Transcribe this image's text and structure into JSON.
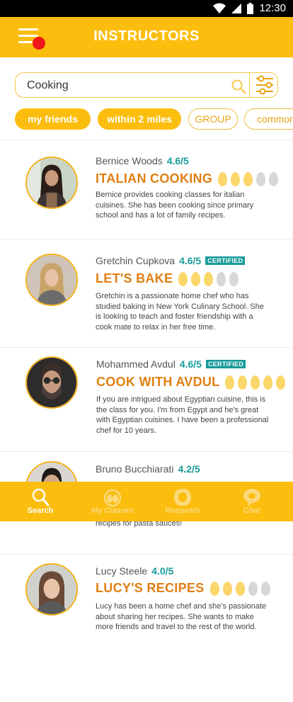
{
  "status_bar": {
    "time": "12:30"
  },
  "header": {
    "title": "INSTRUCTORS"
  },
  "search": {
    "value": "Cooking"
  },
  "filters": [
    {
      "label": "my friends",
      "active": true
    },
    {
      "label": "within 2 miles",
      "active": true
    },
    {
      "label": "GROUP",
      "active": false
    },
    {
      "label": "common",
      "active": false
    }
  ],
  "instructors": [
    {
      "name": "Bernice Woods",
      "rating": "4.6/5",
      "certified": false,
      "course": "ITALIAN COOKING",
      "eggs_filled": 3,
      "eggs_total": 5,
      "description": "Bernice provides cooking classes for italian cuisines. She has been cooking since primary school and has a lot of family recipes."
    },
    {
      "name": "Gretchin Cupkova",
      "rating": "4.6/5",
      "certified": true,
      "badge": "CERTIFIED",
      "course": "LET'S BAKE",
      "eggs_filled": 3,
      "eggs_total": 5,
      "description": "Gretchin is a passionate home chef who has studied baking in New York Culinary School. She is looking to teach and foster friendship with a cook mate to relax in her free time."
    },
    {
      "name": "Mohammed Avdul",
      "rating": "4.6/5",
      "certified": true,
      "badge": "CERTIFIED",
      "course": "COOK WITH AVDUL",
      "eggs_filled": 5,
      "eggs_total": 5,
      "description": "If you are intrigued about Egyptian cuisine, this is the class for you. I'm from Egypt and he's great with Egyptian cuisines. I have been a professional chef for 10 years."
    },
    {
      "name": "Bruno Bucchiarati",
      "rating": "4.2/5",
      "certified": false,
      "description_tail": "recipes for pasta sauces!"
    },
    {
      "name": "Lucy Steele",
      "rating": "4.0/5",
      "certified": false,
      "course": "LUCY'S RECIPES",
      "eggs_filled": 3,
      "eggs_total": 5,
      "description": "Lucy has been a home chef and she's passionate about sharing her recipes. She wants to make more friends and travel to the rest of the world."
    }
  ],
  "nav": [
    {
      "label": "Search",
      "icon": "search-icon",
      "active": true
    },
    {
      "label": "My Classes",
      "icon": "classes-icon",
      "active": false
    },
    {
      "label": "Requests",
      "icon": "requests-icon",
      "active": false
    },
    {
      "label": "Chat",
      "icon": "chat-icon",
      "active": false
    }
  ],
  "colors": {
    "brand": "#fbbd0e",
    "accent": "#e07f12",
    "teal": "#179b9a",
    "notification": "#f01818"
  }
}
